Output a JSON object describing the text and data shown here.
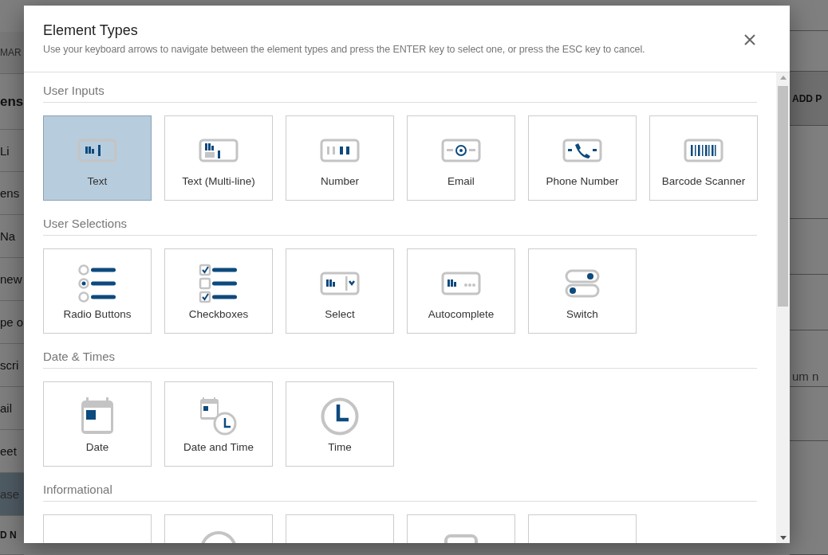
{
  "background": {
    "left_column": [
      {
        "kind": "tab",
        "text": "MAR"
      },
      {
        "kind": "heading",
        "text": "ens"
      },
      {
        "kind": "row",
        "text": "Li"
      },
      {
        "kind": "row",
        "text": "ens"
      },
      {
        "kind": "row",
        "text": "Na"
      },
      {
        "kind": "row",
        "text": "new"
      },
      {
        "kind": "row",
        "text": "pe o"
      },
      {
        "kind": "row",
        "text": "scri"
      },
      {
        "kind": "row",
        "text": "ail"
      },
      {
        "kind": "row",
        "text": "eet"
      },
      {
        "kind": "highlight",
        "text": "ase"
      },
      {
        "kind": "action",
        "text": "D N"
      }
    ],
    "right_column": [
      {
        "kind": "blank"
      },
      {
        "kind": "blank"
      },
      {
        "kind": "action",
        "text": "ADD P"
      },
      {
        "kind": "blank"
      },
      {
        "kind": "blank"
      },
      {
        "kind": "blank"
      },
      {
        "kind": "placeholder",
        "text": "um n"
      },
      {
        "kind": "blank"
      },
      {
        "kind": "blank"
      }
    ]
  },
  "dialog": {
    "title": "Element Types",
    "subtitle": "Use your keyboard arrows to navigate between the element types and press the ENTER key to select one, or press the ESC key to cancel.",
    "sections": [
      {
        "title": "User Inputs",
        "tiles": [
          {
            "kind": "text",
            "label": "Text",
            "selected": true
          },
          {
            "kind": "multiline",
            "label": "Text (Multi-line)",
            "selected": false
          },
          {
            "kind": "number",
            "label": "Number",
            "selected": false
          },
          {
            "kind": "email",
            "label": "Email",
            "selected": false
          },
          {
            "kind": "phone",
            "label": "Phone Number",
            "selected": false
          },
          {
            "kind": "barcode",
            "label": "Barcode Scanner",
            "selected": false
          }
        ]
      },
      {
        "title": "User Selections",
        "tiles": [
          {
            "kind": "radio",
            "label": "Radio Buttons",
            "selected": false
          },
          {
            "kind": "checkbox",
            "label": "Checkboxes",
            "selected": false
          },
          {
            "kind": "select",
            "label": "Select",
            "selected": false
          },
          {
            "kind": "autocomplete",
            "label": "Autocomplete",
            "selected": false
          },
          {
            "kind": "switch",
            "label": "Switch",
            "selected": false
          }
        ]
      },
      {
        "title": "Date & Times",
        "tiles": [
          {
            "kind": "date",
            "label": "Date",
            "selected": false
          },
          {
            "kind": "datetime",
            "label": "Date and Time",
            "selected": false
          },
          {
            "kind": "time",
            "label": "Time",
            "selected": false
          }
        ]
      },
      {
        "title": "Informational",
        "tiles": [
          {
            "kind": "plain",
            "selected": false
          },
          {
            "kind": "circle",
            "selected": false
          },
          {
            "kind": "plain",
            "selected": false
          },
          {
            "kind": "frame",
            "selected": false
          },
          {
            "kind": "plain",
            "selected": false
          }
        ]
      }
    ]
  }
}
